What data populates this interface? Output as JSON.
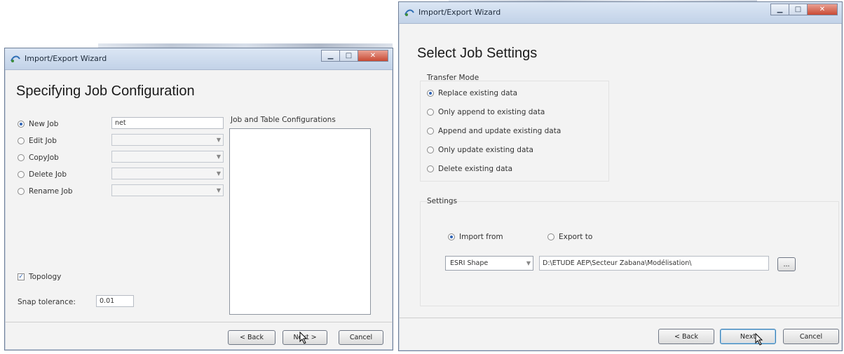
{
  "left_window": {
    "title": "Import/Export Wizard",
    "heading": "Specifying Job Configuration",
    "config_label": "Job and Table Configurations",
    "options": [
      {
        "label": "New Job",
        "selected": true,
        "value": "net"
      },
      {
        "label": "Edit Job",
        "selected": false,
        "value": ""
      },
      {
        "label": "CopyJob",
        "selected": false,
        "value": ""
      },
      {
        "label": "Delete Job",
        "selected": false,
        "value": ""
      },
      {
        "label": "Rename Job",
        "selected": false,
        "value": ""
      }
    ],
    "topology": {
      "label": "Topology",
      "checked": true
    },
    "snap": {
      "label": "Snap tolerance:",
      "value": "0.01"
    },
    "buttons": {
      "back": "< Back",
      "next": "Next >",
      "cancel": "Cancel"
    }
  },
  "right_window": {
    "title": "Import/Export Wizard",
    "heading": "Select Job Settings",
    "transfer_mode": {
      "title": "Transfer Mode",
      "options": [
        {
          "label": "Replace existing data",
          "selected": true
        },
        {
          "label": "Only append to existing data",
          "selected": false
        },
        {
          "label": "Append and update existing data",
          "selected": false
        },
        {
          "label": "Only update existing data",
          "selected": false
        },
        {
          "label": "Delete existing data",
          "selected": false
        }
      ]
    },
    "settings": {
      "title": "Settings",
      "import_label": "Import from",
      "export_label": "Export to",
      "format": "ESRI Shape",
      "path": "D:\\ETUDE AEP\\Secteur Zabana\\Modélisation\\",
      "browse": "..."
    },
    "buttons": {
      "back": "< Back",
      "next": "Next",
      "cancel": "Cancel"
    }
  },
  "colors": {
    "titlebar": "#c2d2e8",
    "close": "#c94a34",
    "radio_on": "#2f63b5"
  }
}
